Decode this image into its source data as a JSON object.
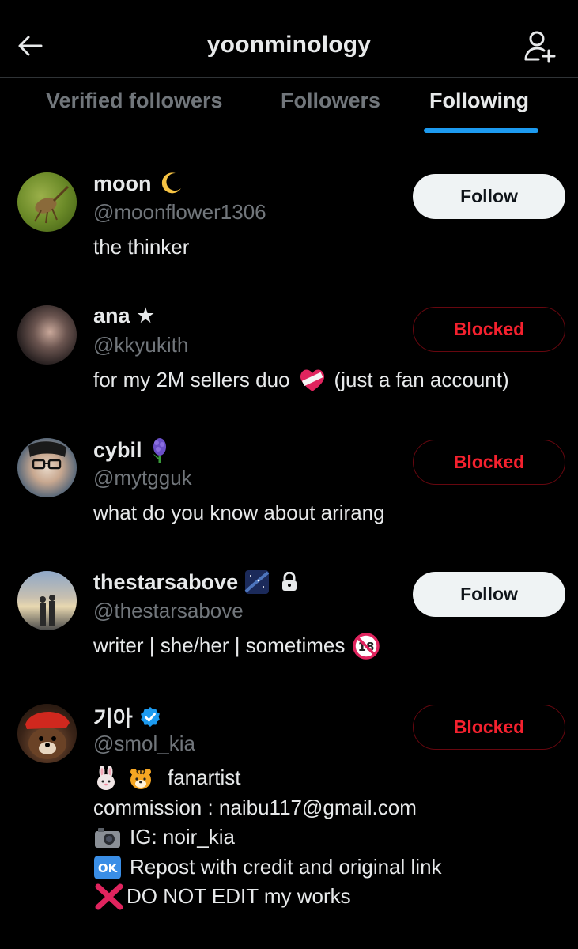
{
  "header": {
    "title": "yoonminology"
  },
  "tabs": [
    {
      "label": "Verified followers"
    },
    {
      "label": "Followers"
    },
    {
      "label": "Following"
    }
  ],
  "colors": {
    "accent": "#1d9bf0",
    "blocked": "#f4212e",
    "verified": "#1d9bf0"
  },
  "users": [
    {
      "name": "moon",
      "name_icon": "crescent-moon-emoji",
      "handle": "@moonflower1306",
      "bio": [
        "the thinker"
      ],
      "button": "Follow"
    },
    {
      "name": "ana ★",
      "handle": "@kkyukith",
      "bio": [
        "for my 2M sellers duo",
        "(just a fan account)"
      ],
      "bio_icon": "bandaged-heart-emoji",
      "button": "Blocked"
    },
    {
      "name": "cybil",
      "name_icon": "hyacinth-emoji",
      "handle": "@mytgguk",
      "bio": [
        "what do you know about arirang"
      ],
      "button": "Blocked"
    },
    {
      "name": "thestarsabove",
      "name_icon": "milky-way-emoji",
      "handle": "@thestarsabove",
      "bio": [
        "writer | she/her | sometimes"
      ],
      "bio_icon": "no-one-under-18-emoji",
      "protected": true,
      "button": "Follow"
    },
    {
      "name": "기아",
      "verified": true,
      "handle": "@smol_kia",
      "bio": [
        "fanartist",
        "commission : naibu117@gmail.com",
        "IG: noir_kia",
        "Repost with credit and original link",
        "DO NOT EDIT my works"
      ],
      "button": "Blocked"
    }
  ]
}
